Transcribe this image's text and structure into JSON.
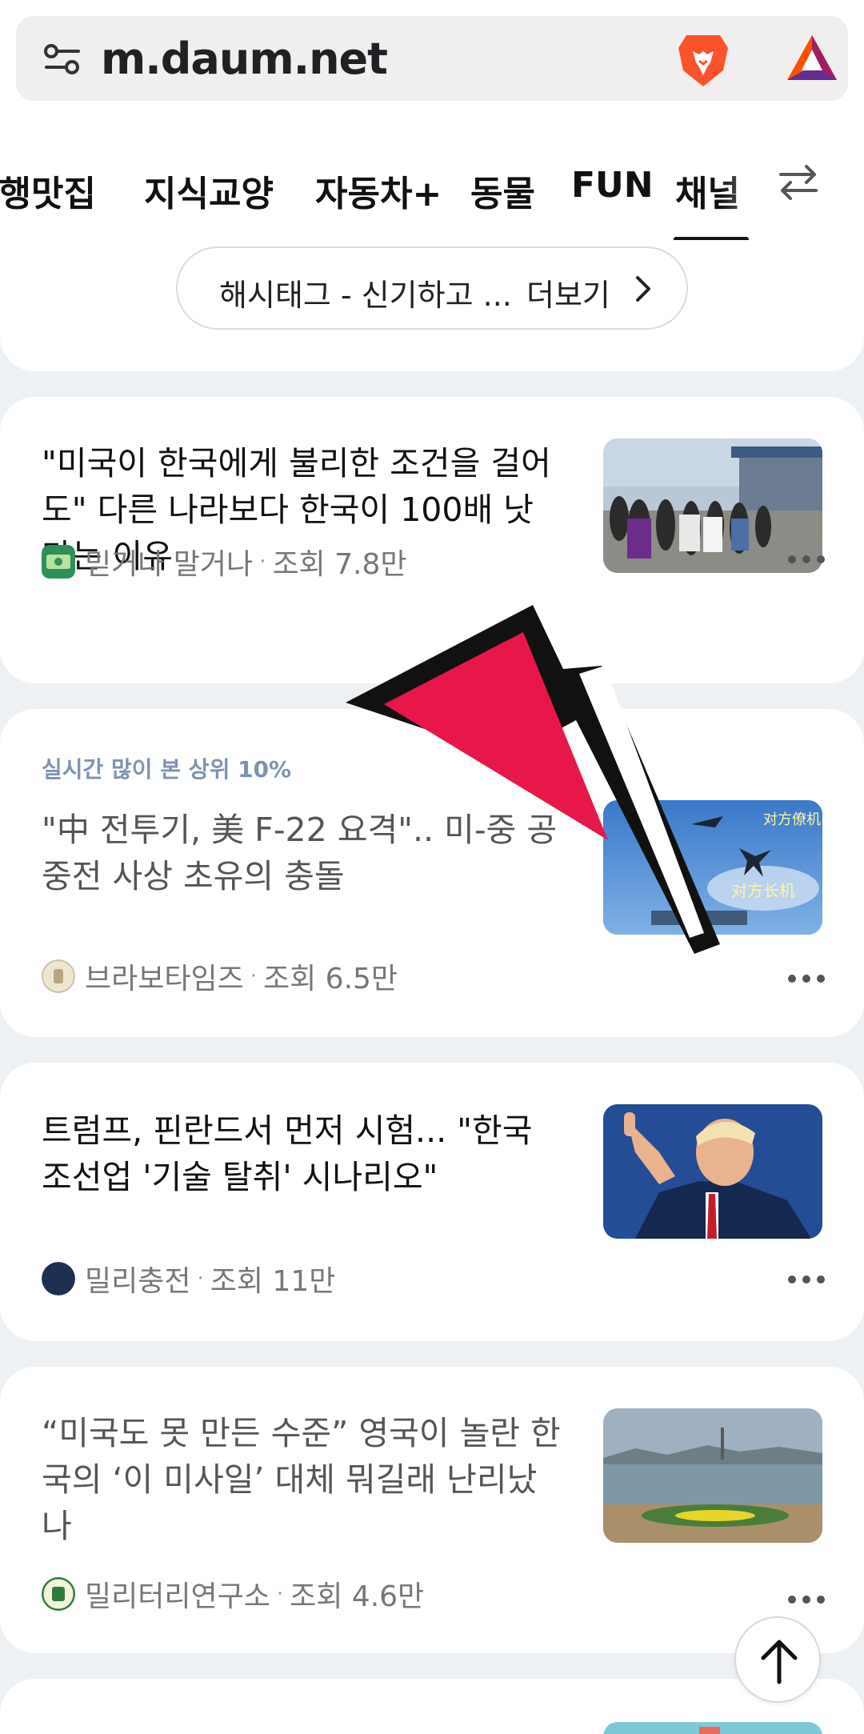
{
  "browser": {
    "url": "m.daum.net",
    "settings_icon": "tune-icon",
    "brave_icon": "brave-lion-icon",
    "rewards_icon": "bat-triangle-icon"
  },
  "tabs": [
    {
      "label": "여행맛집"
    },
    {
      "label": "지식교양"
    },
    {
      "label": "자동차+"
    },
    {
      "label": "동물"
    },
    {
      "label": "FUN"
    },
    {
      "label": "채널"
    }
  ],
  "hashtag": {
    "text": "해시태그 - 신기하고 ...",
    "more": "더보기"
  },
  "articles": [
    {
      "title": "\"미국이 한국에게 불리한 조건을 걸어도\" 다른 나라보다 한국이 100배 낫다는 이유",
      "source": "믿거나 말거나",
      "views": "조회 7.8만",
      "read": false
    },
    {
      "badge": "실시간 많이 본 상위 10%",
      "title": "\"中 전투기, 美 F-22 요격\".. 미-중 공중전 사상 초유의 충돌",
      "source": "브라보타임즈",
      "views": "조회 6.5만",
      "read": true,
      "thumb_caption_1": "对方僚机",
      "thumb_caption_2": "对方长机"
    },
    {
      "title": "트럼프, 핀란드서 먼저 시험... \"한국 조선업 '기술 탈취' 시나리오\"",
      "source": "밀리충전",
      "views": "조회 11만",
      "read": false,
      "avatar_text": "밀리충전"
    },
    {
      "title": "“미국도 못 만든 수준” 영국이 놀란 한국의 ‘이 미사일’ 대체 뭐길래 난리났나",
      "source": "밀리터리연구소",
      "views": "조회 4.6만",
      "read": true
    }
  ],
  "colors": {
    "accent_badge": "#7d93b4",
    "cursor_fill": "#e8174a",
    "background": "#eef1f4"
  }
}
